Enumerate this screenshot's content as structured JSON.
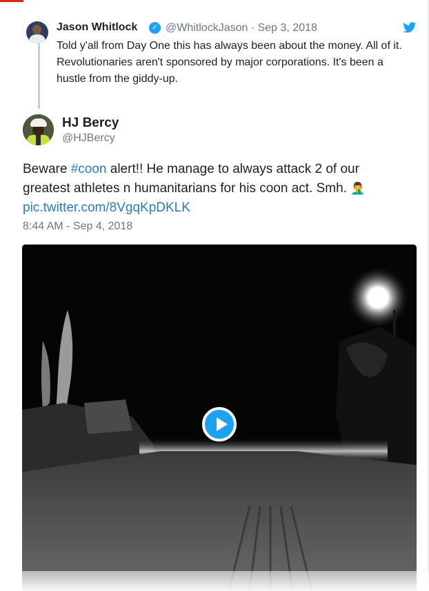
{
  "quoted_tweet": {
    "author_name": "Jason Whitlock",
    "verified_glyph": "✓",
    "handle_and_date": "@WhitlockJason · Sep 3, 2018",
    "text": "Told y'all from Day One this has always been about the money. All of it.  Revolutionaries aren't sponsored by major corporations. It's been a hustle from the giddy-up.",
    "icons": [
      "avatar",
      "verified-badge-icon",
      "twitter-bird-icon"
    ]
  },
  "tweet": {
    "author_name": "HJ Bercy",
    "handle": "@HJBercy",
    "text_before": "Beware ",
    "hashtag": "#coon",
    "text_after": " alert!!  He manage to always attack 2 of our greatest athletes n humanitarians for his coon act.  Smh. ",
    "emoji": "🤦‍♂️",
    "link": "pic.twitter.com/8VgqKpDKLK",
    "timestamp": "8:44 AM - Sep 4, 2018"
  },
  "media": {
    "type": "video",
    "scene": "night road with street lamp",
    "icon": "play-button-icon"
  },
  "colors": {
    "link": "#2b7bb9",
    "verified": "#1da1f2",
    "meta_gray": "#697882",
    "accent_red": "#e0261b"
  }
}
